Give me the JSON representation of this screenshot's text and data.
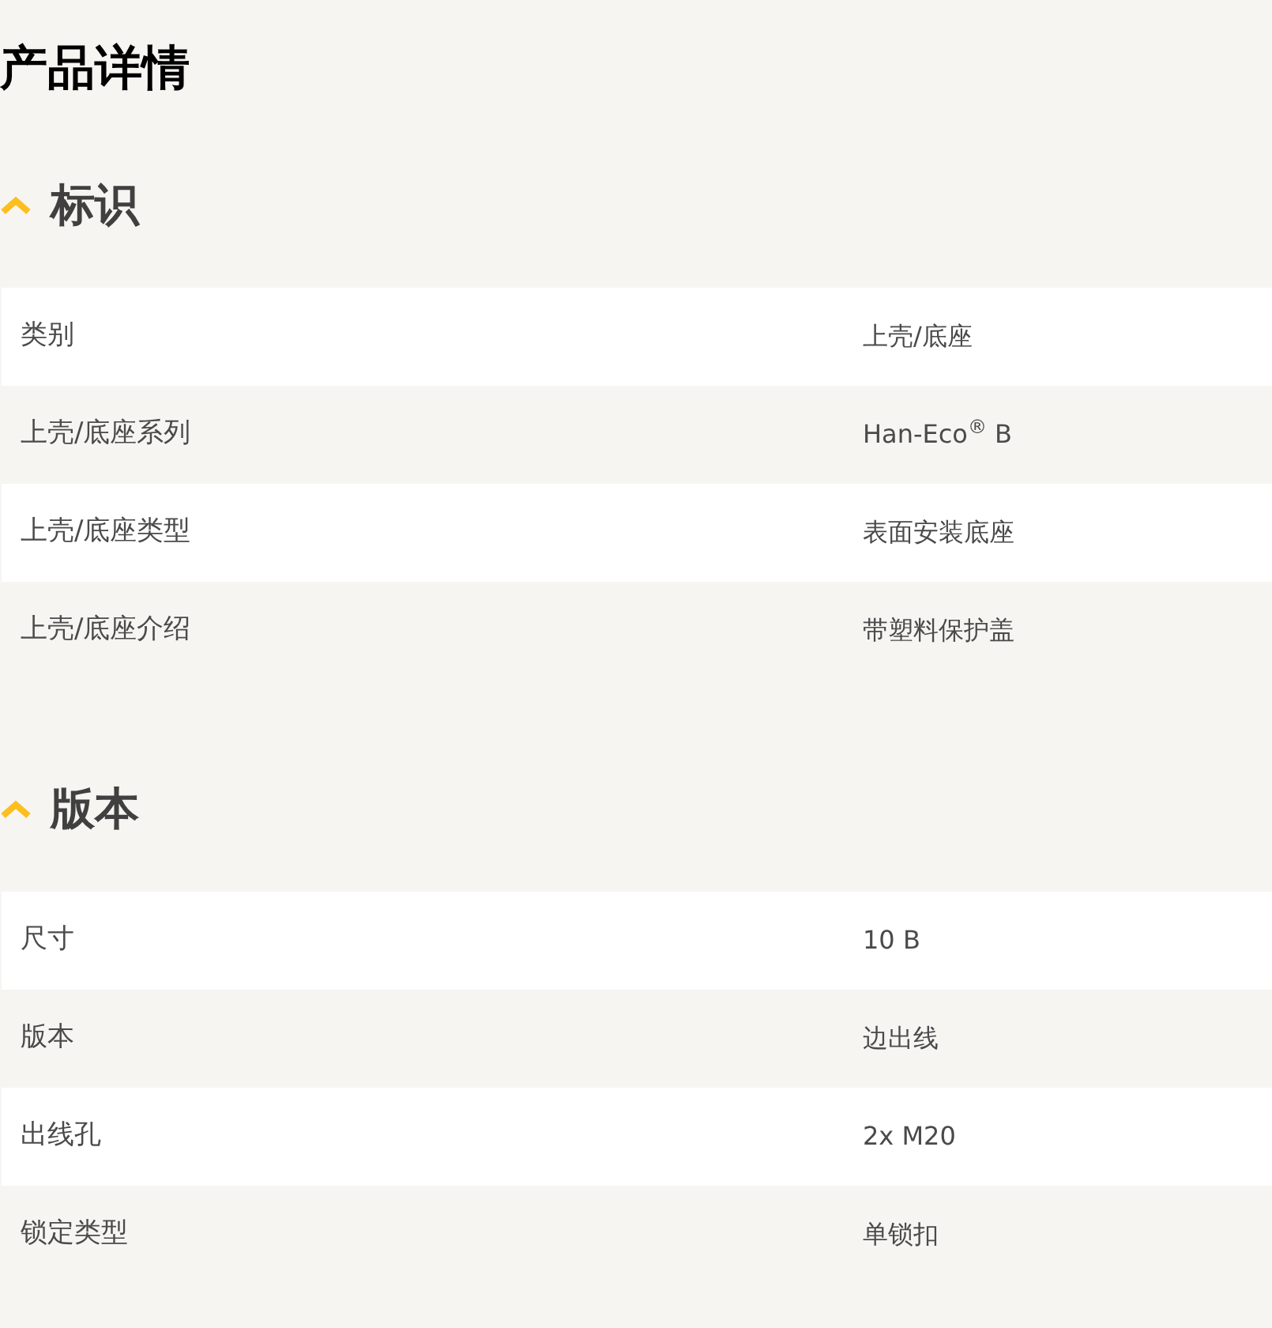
{
  "title": "产品详情",
  "sections": [
    {
      "heading": "标识",
      "expanded": true,
      "rows": [
        {
          "label": "类别",
          "value": "上壳/底座"
        },
        {
          "label": "上壳/底座系列",
          "value": "Han-Eco$^{®}$ B"
        },
        {
          "label": "上壳/底座类型",
          "value": "表面安装底座"
        },
        {
          "label": "上壳/底座介绍",
          "value": "带塑料保护盖"
        }
      ]
    },
    {
      "heading": "版本",
      "expanded": true,
      "rows": [
        {
          "label": "尺寸",
          "value": "10 B"
        },
        {
          "label": "版本",
          "value": "边出线"
        },
        {
          "label": "出线孔",
          "value": "2x M20"
        },
        {
          "label": "锁定类型",
          "value": "单锁扣"
        }
      ]
    }
  ]
}
